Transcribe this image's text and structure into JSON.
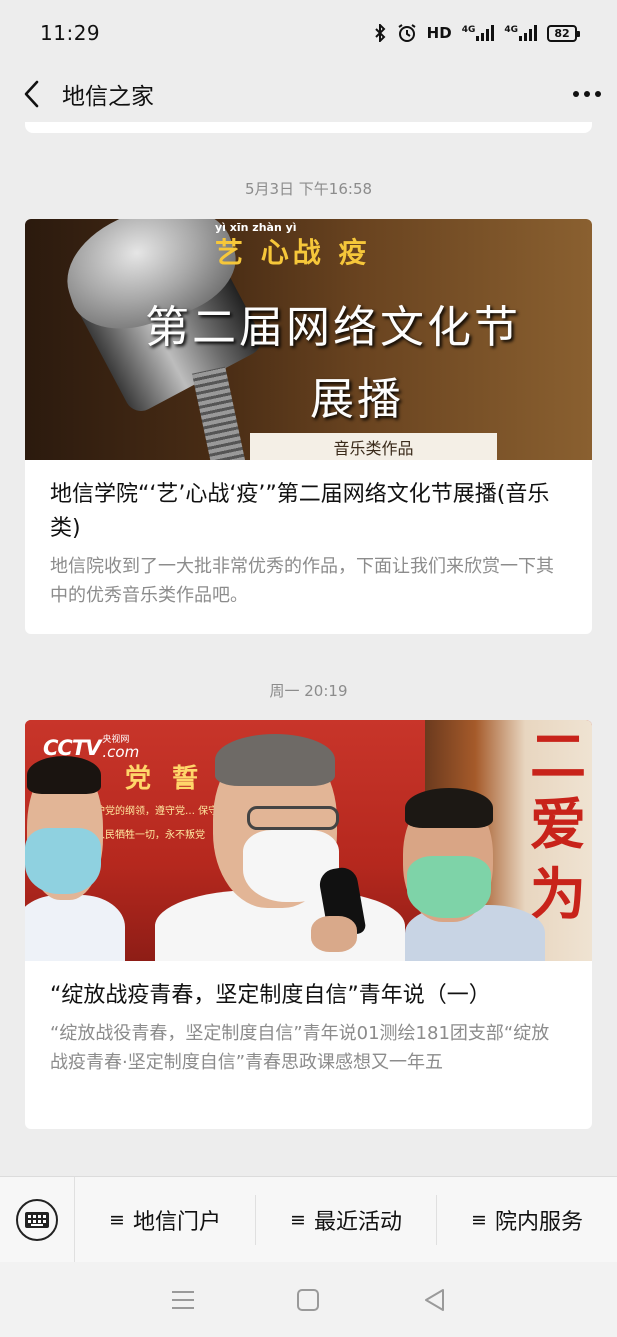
{
  "status_bar": {
    "time": "11:29",
    "network_label": "HD",
    "signal1_label": "4G",
    "signal2_label": "4G",
    "battery": "82"
  },
  "nav": {
    "title": "地信之家"
  },
  "feed": [
    {
      "timestamp": "5月3日 下午16:58",
      "image": {
        "pinyin": "yì      xīn zhàn      yì",
        "yi_line": "艺 心战 疫",
        "line1": "第二届网络文化节",
        "line2": "展播",
        "label": "音乐类作品"
      },
      "title": "地信学院“‘艺’心战‘疫’”第二届网络文化节展播(音乐类)",
      "desc": "地信院收到了一大批非常优秀的作品，下面让我们来欣赏一下其中的优秀音乐类作品吧。"
    },
    {
      "timestamp": "周一 20:19",
      "image": {
        "logo_main": "CCTV",
        "logo_cn": "央视网",
        "logo_com": ".com",
        "oath_title": "党 誓 词",
        "oath_text": "护党的纲领，遵守党… 保守党的秘密，对党… 人民牺牲一切，永不叛党"
      },
      "title": "“绽放战疫青春，坚定制度自信”青年说（一）",
      "desc": "“绽放战役青春，坚定制度自信”青年说01测绘181团支部“绽放战疫青春·坚定制度自信”青春思政课感想又一年五"
    }
  ],
  "menu": {
    "items": [
      {
        "label": "地信门户"
      },
      {
        "label": "最近活动"
      },
      {
        "label": "院内服务"
      }
    ]
  },
  "colors": {
    "background": "#ededed",
    "card": "#ffffff",
    "muted_text": "#8c8c8c",
    "accent_yellow": "#f6c73a"
  },
  "icons": {
    "back": "chevron-left-icon",
    "more": "more-dots-icon",
    "keyboard": "keyboard-icon",
    "menu": "list-icon"
  }
}
